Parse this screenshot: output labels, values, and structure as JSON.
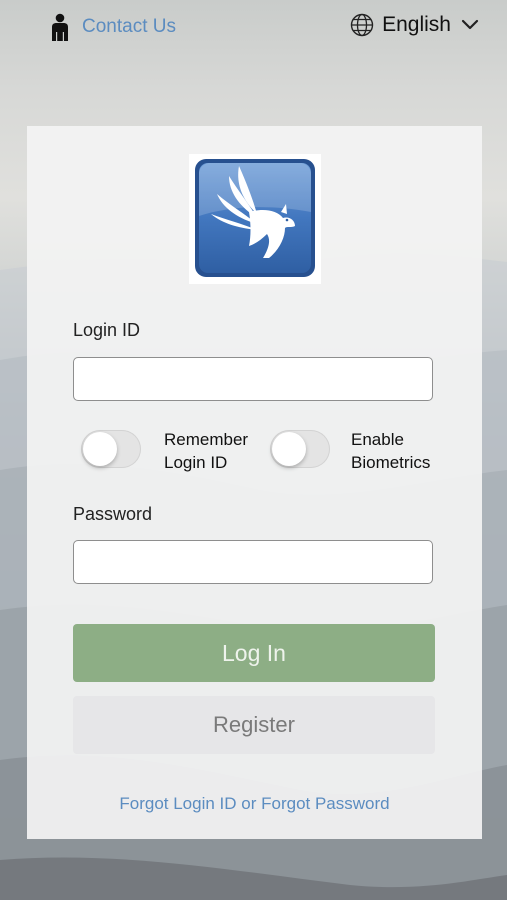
{
  "header": {
    "contact_label": "Contact Us",
    "contact_icon": "person-icon",
    "language_label": "English",
    "language_icon": "globe-icon",
    "dropdown_icon": "chevron-down-icon"
  },
  "login_form": {
    "login_id_label": "Login ID",
    "login_id_value": "",
    "remember_label_line1": "Remember",
    "remember_label_line2": "Login ID",
    "remember_on": false,
    "biometrics_label_line1": "Enable",
    "biometrics_label_line2": "Biometrics",
    "biometrics_on": false,
    "password_label": "Password",
    "password_value": "",
    "login_button": "Log In",
    "register_button": "Register",
    "forgot_link": "Forgot Login ID or Forgot Password"
  },
  "colors": {
    "link": "#5b8cc0",
    "login_button": "#8dae85",
    "register_button": "#e6e6e8",
    "logo_blue": "#3f73b8"
  }
}
